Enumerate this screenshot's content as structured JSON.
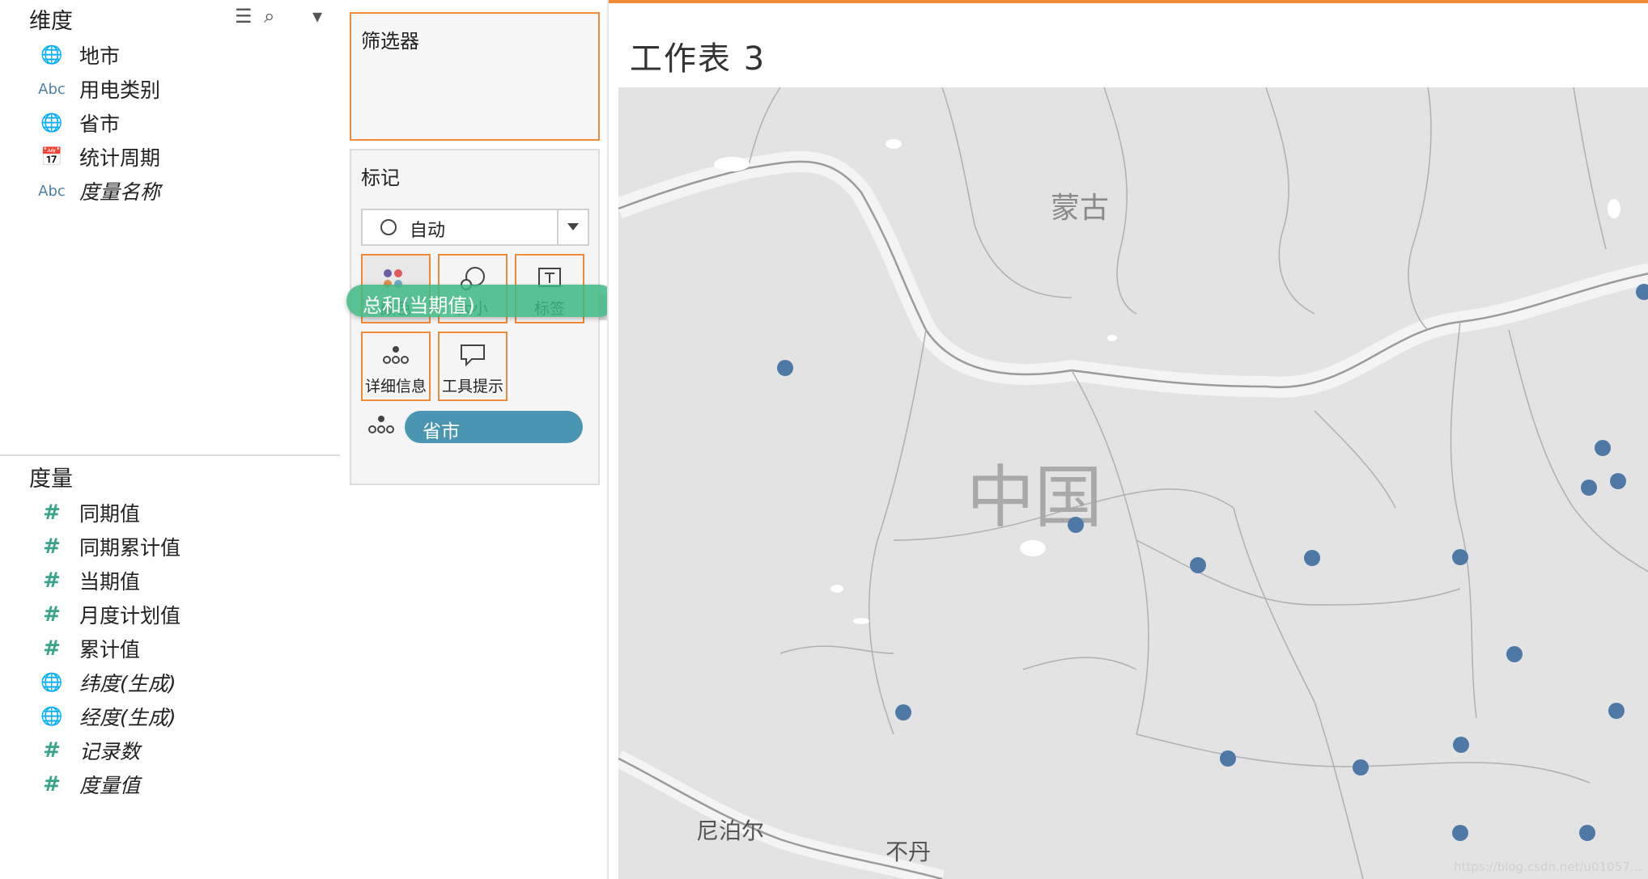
{
  "data_pane": {
    "dimensions_title": "维度",
    "dimensions": [
      {
        "icon": "globe-icon",
        "name": "地市",
        "italic": false
      },
      {
        "icon": "abc-icon",
        "name": "用电类别",
        "italic": false
      },
      {
        "icon": "globe-icon",
        "name": "省市",
        "italic": false
      },
      {
        "icon": "calendar-icon",
        "name": "统计周期",
        "italic": false
      },
      {
        "icon": "abc-icon",
        "name": "度量名称",
        "italic": true
      }
    ],
    "measures_title": "度量",
    "measures": [
      {
        "icon": "hash-icon",
        "name": "同期值",
        "italic": false
      },
      {
        "icon": "hash-icon",
        "name": "同期累计值",
        "italic": false
      },
      {
        "icon": "hash-icon",
        "name": "当期值",
        "italic": false
      },
      {
        "icon": "hash-icon",
        "name": "月度计划值",
        "italic": false
      },
      {
        "icon": "hash-icon",
        "name": "累计值",
        "italic": false
      },
      {
        "icon": "globe-icon",
        "name": "纬度(生成)",
        "italic": true
      },
      {
        "icon": "globe-icon",
        "name": "经度(生成)",
        "italic": true
      },
      {
        "icon": "hash-icon",
        "name": "记录数",
        "italic": true
      },
      {
        "icon": "hash-icon",
        "name": "度量值",
        "italic": true
      }
    ],
    "icons": {
      "globe": "🌐",
      "abc": "Abc",
      "calendar": "📅",
      "hash": "#",
      "list_view": "☰",
      "search": "⌕",
      "menu": "▾"
    }
  },
  "filters_card": {
    "title": "筛选器"
  },
  "marks_card": {
    "title": "标记",
    "mark_type": "自动",
    "buttons": [
      {
        "id": "color",
        "label": "颜色"
      },
      {
        "id": "size",
        "label": "大小"
      },
      {
        "id": "label",
        "label": "标签"
      },
      {
        "id": "detail",
        "label": "详细信息"
      },
      {
        "id": "tooltip",
        "label": "工具提示"
      }
    ],
    "detail_pill": "省市"
  },
  "drag_pill": "总和(当期值)",
  "view": {
    "sheet_title": "工作表 3",
    "map_labels": {
      "mongolia": "蒙古",
      "china": "中国",
      "nepal": "尼泊尔",
      "bhutan": "不丹"
    },
    "mark_color": "#4e79a7",
    "accent": "#ef8a3a"
  },
  "watermark": "https://blog.csdn.net/u01057..."
}
